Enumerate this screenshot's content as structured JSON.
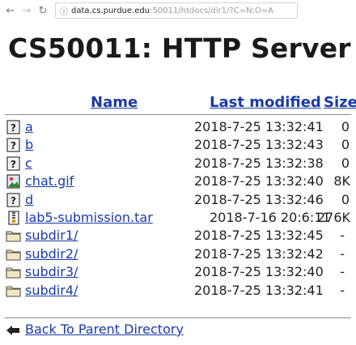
{
  "browser": {
    "back_icon": "←",
    "forward_icon": "→",
    "reload_icon": "↻",
    "info_icon": "ⓘ",
    "url_host": "data.cs.purdue.edu",
    "url_rest": ":50011/htdocs/dir1/?C=N;O=A"
  },
  "page": {
    "title": "CS50011: HTTP Server"
  },
  "columns": {
    "name": "Name",
    "modified": "Last modified",
    "size": "Size"
  },
  "rows": [
    {
      "name": "a",
      "modified": "2018-7-25 13:32:41",
      "size": "0",
      "icon": "unknown-file-icon"
    },
    {
      "name": "b",
      "modified": "2018-7-25 13:32:43",
      "size": "0",
      "icon": "unknown-file-icon"
    },
    {
      "name": "c",
      "modified": "2018-7-25 13:32:38",
      "size": "0",
      "icon": "unknown-file-icon"
    },
    {
      "name": "chat.gif",
      "modified": "2018-7-25 13:32:40",
      "size": "8K",
      "icon": "image-file-icon"
    },
    {
      "name": "d",
      "modified": "2018-7-25 13:32:46",
      "size": "0",
      "icon": "unknown-file-icon"
    },
    {
      "name": "lab5-submission.tar",
      "modified": "2018-7-16 20:6:11",
      "size": "276K",
      "icon": "archive-file-icon"
    },
    {
      "name": "subdir1/",
      "modified": "2018-7-25 13:32:45",
      "size": "-",
      "icon": "folder-icon"
    },
    {
      "name": "subdir2/",
      "modified": "2018-7-25 13:32:42",
      "size": "-",
      "icon": "folder-icon"
    },
    {
      "name": "subdir3/",
      "modified": "2018-7-25 13:32:40",
      "size": "-",
      "icon": "folder-icon"
    },
    {
      "name": "subdir4/",
      "modified": "2018-7-25 13:32:41",
      "size": "-",
      "icon": "folder-icon"
    }
  ],
  "parent_link": {
    "label": "Back To Parent Directory",
    "icon": "back-arrow-icon"
  }
}
